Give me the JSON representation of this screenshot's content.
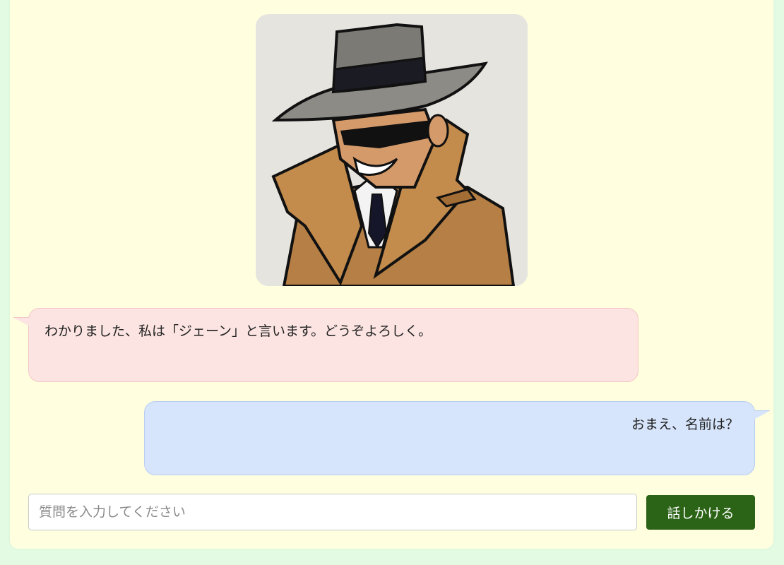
{
  "avatar": {
    "alt": "detective-character",
    "bg_color": "#e6e4df"
  },
  "chat": {
    "messages": [
      {
        "role": "ai",
        "text": "わかりました、私は「ジェーン」と言います。どうぞよろしく。"
      },
      {
        "role": "user",
        "text": "おまえ、名前は？"
      }
    ]
  },
  "composer": {
    "placeholder": "質問を入力してください",
    "value": "",
    "send_label": "話しかける"
  },
  "colors": {
    "page_bg": "#e2fbe2",
    "card_bg": "#ffffe0",
    "ai_bubble": "#fbe4e1",
    "user_bubble": "#d6e5fb",
    "button": "#2b6317"
  }
}
